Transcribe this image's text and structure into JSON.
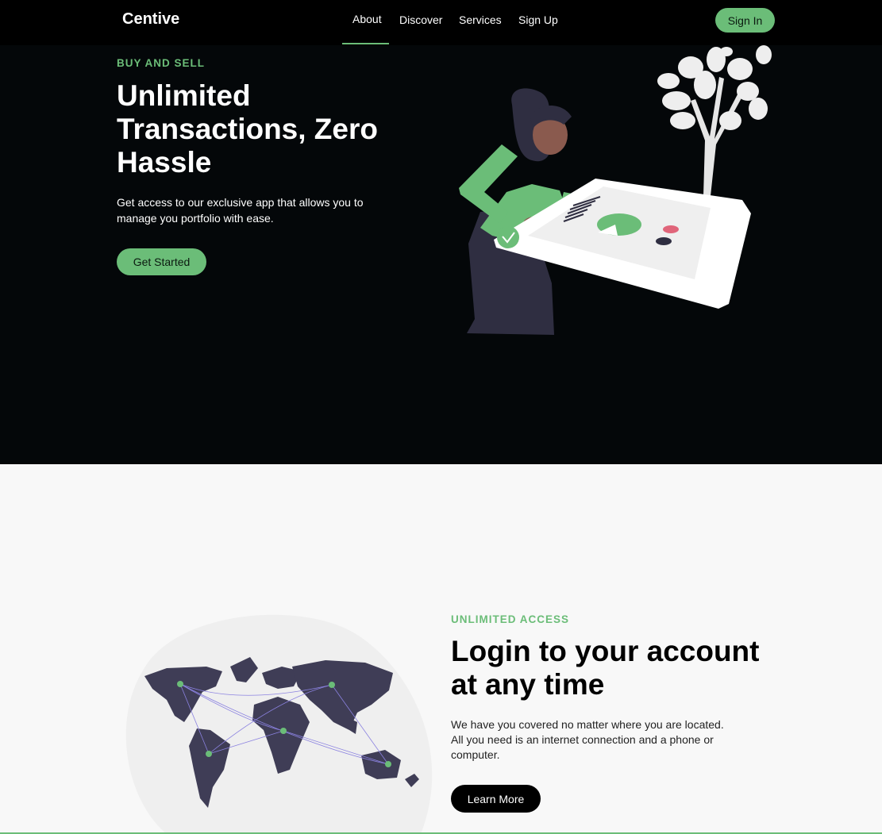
{
  "nav": {
    "logo": "Centive",
    "links": [
      "About",
      "Discover",
      "Services",
      "Sign Up"
    ],
    "signin": "Sign In"
  },
  "hero": {
    "eyebrow": "BUY AND SELL",
    "title": "Unlimited Transactions, Zero Hassle",
    "description": "Get access to our exclusive app that allows you to manage you portfolio with ease.",
    "cta": "Get Started"
  },
  "access": {
    "eyebrow": "UNLIMITED ACCESS",
    "title": "Login to your account at any time",
    "description": "We have you covered no matter where you are located. All you need is an internet connection and a phone or computer.",
    "cta": "Learn More"
  },
  "colors": {
    "accent": "#6bbd78",
    "hero_bg": "#040709",
    "section_bg": "#f8f8f8"
  }
}
